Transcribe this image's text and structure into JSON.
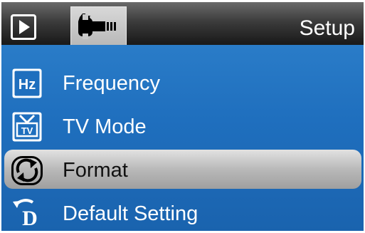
{
  "header": {
    "title": "Setup"
  },
  "tabs": [
    {
      "name": "play-tab",
      "icon": "play-icon",
      "active": false
    },
    {
      "name": "setup-tab",
      "icon": "wrench-icon",
      "active": true
    }
  ],
  "menu": {
    "items": [
      {
        "label": "Frequency",
        "icon": "hz-icon",
        "selected": false
      },
      {
        "label": "TV Mode",
        "icon": "tv-icon",
        "selected": false
      },
      {
        "label": "Format",
        "icon": "format-icon",
        "selected": true
      },
      {
        "label": "Default Setting",
        "icon": "default-setting-icon",
        "selected": false
      }
    ]
  },
  "colors": {
    "menu_background": "#1f6fbe",
    "header_background": "#1c1c1c",
    "selection_bar": "#b9b9b9",
    "text": "#ffffff"
  }
}
